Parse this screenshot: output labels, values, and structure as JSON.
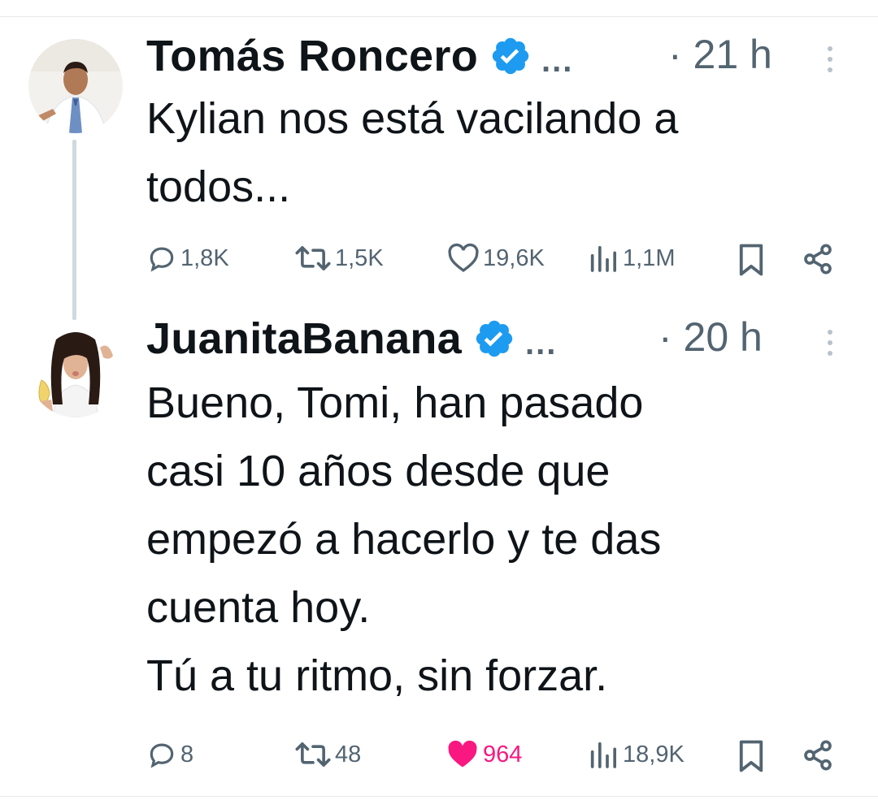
{
  "tweets": [
    {
      "author": "Tomás Roncero",
      "verified": true,
      "ellipsis": "...",
      "time": "· 21 h",
      "avatar": "man-pointing-avatar",
      "lines": [
        "Kylian nos está vacilando a",
        "todos..."
      ],
      "stats": {
        "replies": "1,8K",
        "retweets": "1,5K",
        "likes": "19,6K",
        "views": "1,1M"
      },
      "liked": false
    },
    {
      "author": "JuanitaBanana",
      "verified": true,
      "ellipsis": "...",
      "time": "· 20 h",
      "avatar": "woman-with-banana-avatar",
      "lines": [
        "Bueno, Tomi, han pasado",
        "casi 10 años desde que",
        "empezó a hacerlo y te das",
        "cuenta hoy.",
        "Tú a tu ritmo, sin forzar."
      ],
      "stats": {
        "replies": "8",
        "retweets": "48",
        "likes": "964",
        "views": "18,9K"
      },
      "liked": true
    }
  ],
  "colors": {
    "accent": "#1d9bf0",
    "like": "#f91880",
    "muted": "#536471",
    "text": "#0f1419"
  },
  "icons": [
    "reply-icon",
    "retweet-icon",
    "like-icon",
    "views-icon",
    "bookmark-icon",
    "share-icon",
    "verified-badge-icon",
    "more-options-icon"
  ]
}
